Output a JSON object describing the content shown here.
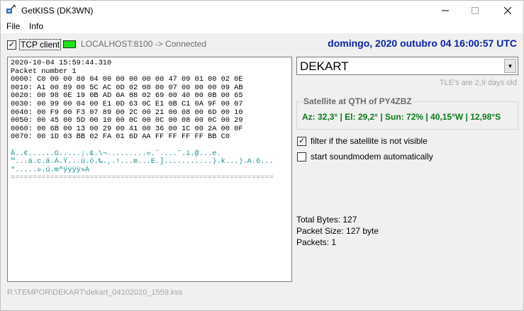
{
  "window": {
    "title": "GetKISS (DK3WN)",
    "minimize_icon": "minimize-icon",
    "maximize_icon": "maximize-icon",
    "close_icon": "close-icon"
  },
  "menu": {
    "file": "File",
    "info": "Info"
  },
  "connection": {
    "tcp_checked": true,
    "tcp_label": "TCP client",
    "led_color": "#1be41b",
    "status_text": "LOCALHOST:8100 -> Connected"
  },
  "datetime": "domingo, 2020 outubro 04  16:00:57 UTC",
  "log": {
    "header_lines": [
      "2020-10-04 15:59:44.310",
      "Packet number 1"
    ],
    "hex_lines": [
      "0000: C0 00 00 80 04 00 00 00 00 00 47 09 01 00 02 0E",
      "0010: A1 00 89 00 5C AC 0D 02 08 00 07 00 00 00 09 AB",
      "0020: 00 98 0E 19 0B AD 0A 88 02 69 00 40 00 0B 00 65",
      "0030: 00 99 00 04 00 E1 0D 63 0C E1 0B C1 0A 9F 00 07",
      "0040: 00 F9 00 F3 07 89 00 2C 00 21 00 08 00 6D 00 10",
      "0050: 00 45 00 5D 00 10 00 0C 00 0C 00 08 00 0C 00 29",
      "0060: 00 6B 00 13 00 29 00 41 00 36 00 1C 00 2A 00 0F",
      "0070: 00 1D 03 BB 02 FA 01 6D AA FF FF FF FF BB C0"
    ],
    "ascii_lines": [
      "À..€......G.....¡.&.\\¬.........«.ˆ....˜.i.@...e.",
      "™...á.c.á.Á.Ÿ...ù.ó.‰.,.!...m...E.]...........).k...).A.6...",
      "*.....».ú.mªÿÿÿÿ»À"
    ],
    "separator": "============================================================"
  },
  "satellite": {
    "selected": "DEKART",
    "dropdown_icon": "chevron-down-icon",
    "tle_note": "TLE's are 2,9 days old",
    "qth_title": "Satellite at QTH of PY4ZBZ",
    "qth_values": "Az: 32,3° | El: 29,2° | Sun: 72% | 40,15°W | 12,98°S"
  },
  "options": {
    "filter_checked": true,
    "filter_label": "filter if the satellite is not visible",
    "soundmodem_checked": false,
    "soundmodem_label": "start soundmodem automatically"
  },
  "stats": {
    "total_bytes": "Total Bytes: 127",
    "packet_size": "Packet Size: 127 byte",
    "packets": "Packets: 1"
  },
  "filepath": "R:\\TEMPOR\\DEKART\\dekart_04102020_1559.kss"
}
